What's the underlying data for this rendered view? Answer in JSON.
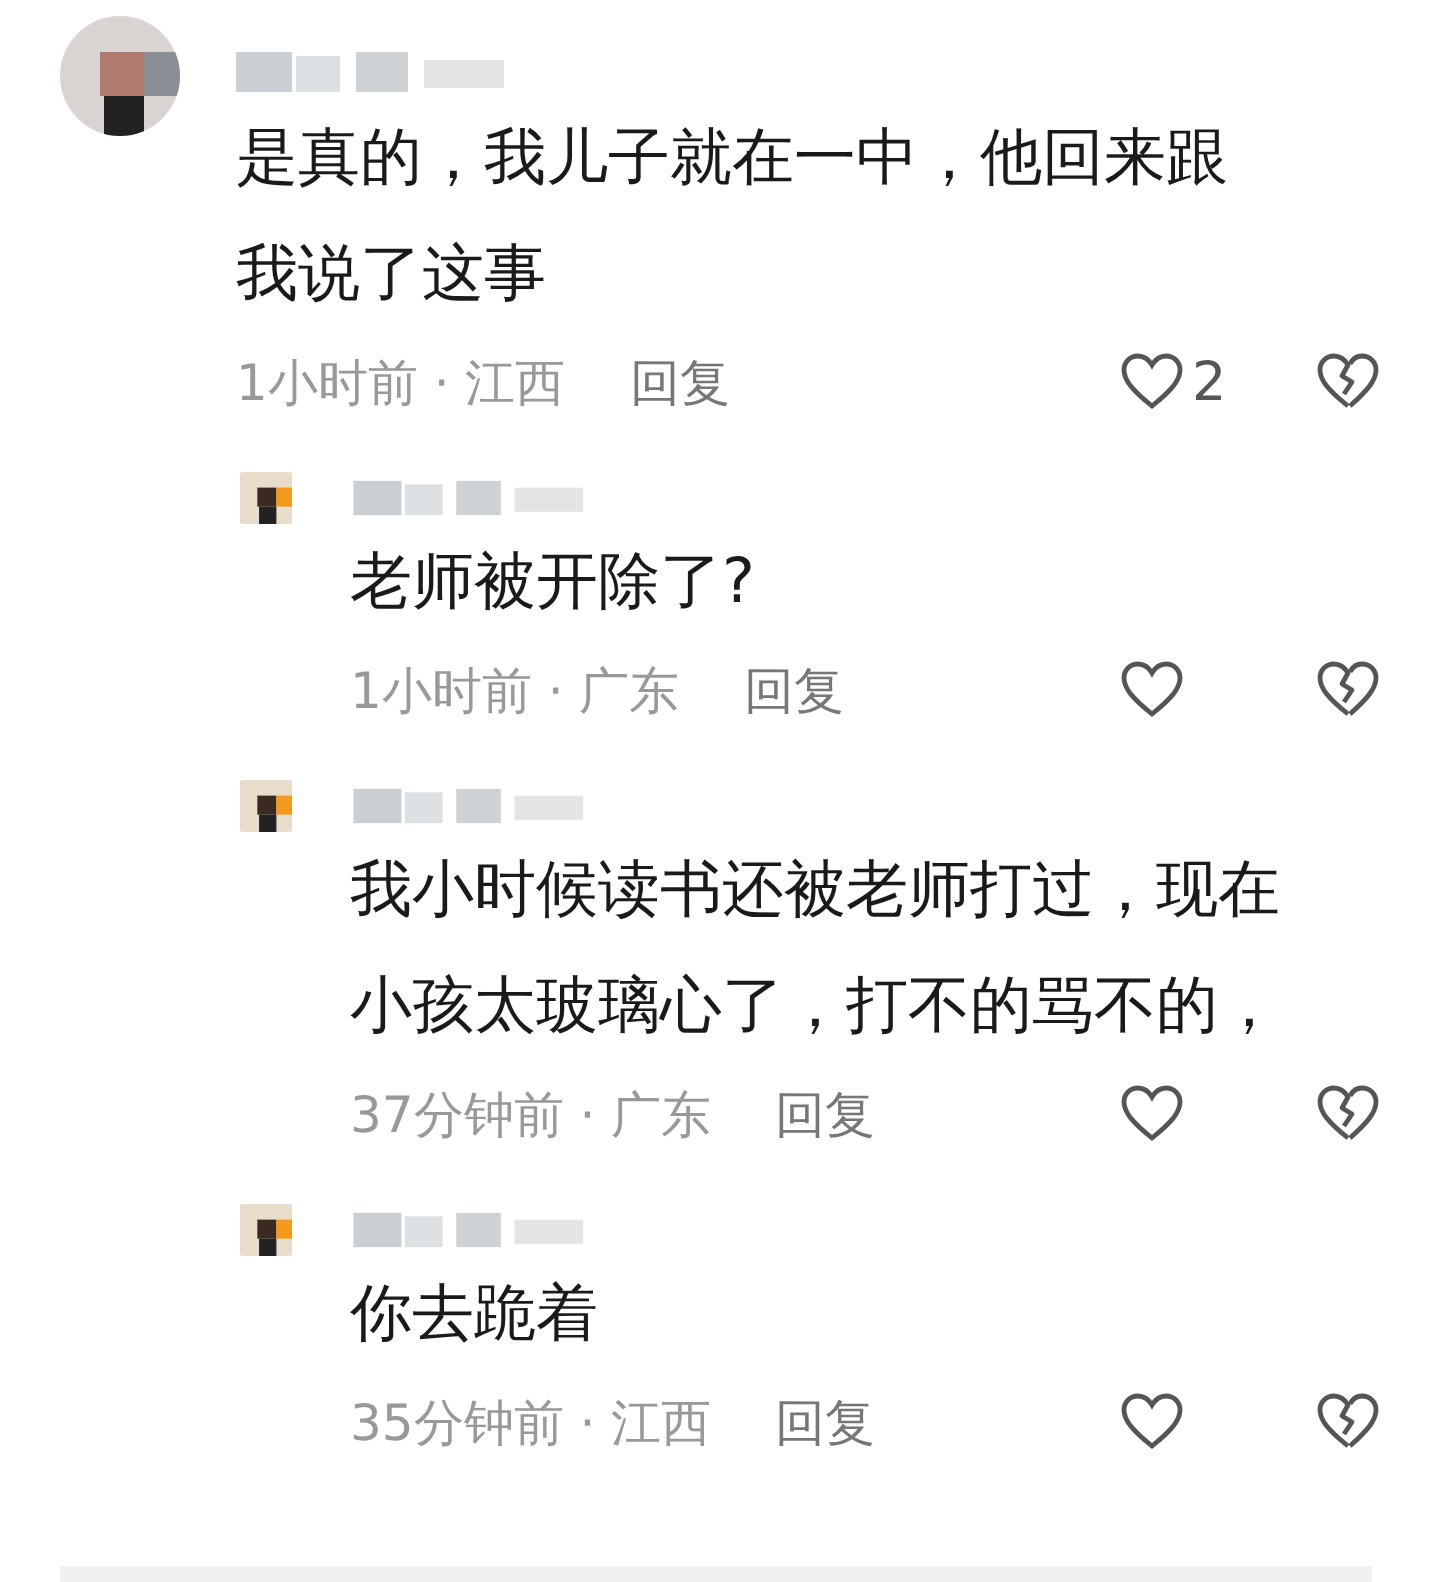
{
  "comments": [
    {
      "text": "是真的，我儿子就在一中，他回来跟我说了这事",
      "time": "1小时前",
      "separator": "·",
      "location": "江西",
      "reply": "回复",
      "likes": "2",
      "replies": [
        {
          "text": "老师被开除了?",
          "time": "1小时前",
          "separator": "·",
          "location": "广东",
          "reply": "回复"
        },
        {
          "text": "我小时候读书还被老师打过，现在小孩太玻璃心了，打不的骂不的，",
          "time": "37分钟前",
          "separator": "·",
          "location": "广东",
          "reply": "回复"
        },
        {
          "text": "你去跪着",
          "time": "35分钟前",
          "separator": "·",
          "location": "江西",
          "reply": "回复"
        }
      ]
    }
  ]
}
